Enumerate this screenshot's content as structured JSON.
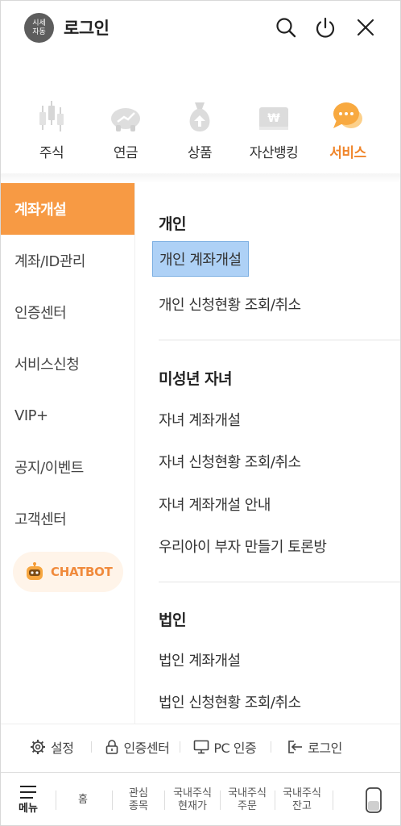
{
  "header": {
    "avatar_line1": "시세",
    "avatar_line2": "자동",
    "title": "로그인",
    "icons": [
      "search-icon",
      "power-icon",
      "close-icon"
    ]
  },
  "categories": [
    {
      "label": "주식",
      "icon": "stock-candle-icon",
      "active": false
    },
    {
      "label": "연금",
      "icon": "piggy-bank-icon",
      "active": false
    },
    {
      "label": "상품",
      "icon": "money-bag-icon",
      "active": false
    },
    {
      "label": "자산뱅킹",
      "icon": "bank-card-icon",
      "active": false
    },
    {
      "label": "서비스",
      "icon": "chat-bubble-icon",
      "active": true
    }
  ],
  "sidebar": {
    "items": [
      {
        "label": "계좌개설",
        "active": true
      },
      {
        "label": "계좌/ID관리",
        "active": false
      },
      {
        "label": "인증센터",
        "active": false
      },
      {
        "label": "서비스신청",
        "active": false
      },
      {
        "label": "VIP+",
        "active": false
      },
      {
        "label": "공지/이벤트",
        "active": false
      },
      {
        "label": "고객센터",
        "active": false
      }
    ],
    "chatbot_label": "CHATBOT"
  },
  "main": {
    "sections": [
      {
        "title": "개인",
        "items": [
          "개인 계좌개설",
          "개인 신청현황 조회/취소"
        ]
      },
      {
        "title": "미성년 자녀",
        "items": [
          "자녀 계좌개설",
          "자녀 신청현황 조회/취소",
          "자녀 계좌개설 안내",
          "우리아이 부자 만들기 토론방"
        ]
      },
      {
        "title": "법인",
        "items": [
          "법인 계좌개설",
          "법인 신청현황 조회/취소"
        ]
      }
    ],
    "highlighted_item": "개인 계좌개설"
  },
  "footer": {
    "settings": "설정",
    "auth_center": "인증센터",
    "pc_auth": "PC 인증",
    "login": "로그인"
  },
  "tabbar": {
    "menu": "메뉴",
    "home": "홈",
    "watch_l1": "관심",
    "watch_l2": "종목",
    "price_l1": "국내주식",
    "price_l2": "현재가",
    "order_l1": "국내주식",
    "order_l2": "주문",
    "balance_l1": "국내주식",
    "balance_l2": "잔고"
  },
  "colors": {
    "accent": "#f79a44",
    "accent_text": "#f0852a",
    "highlight": "#aed1f6",
    "avatar": "#5d5d5d"
  }
}
